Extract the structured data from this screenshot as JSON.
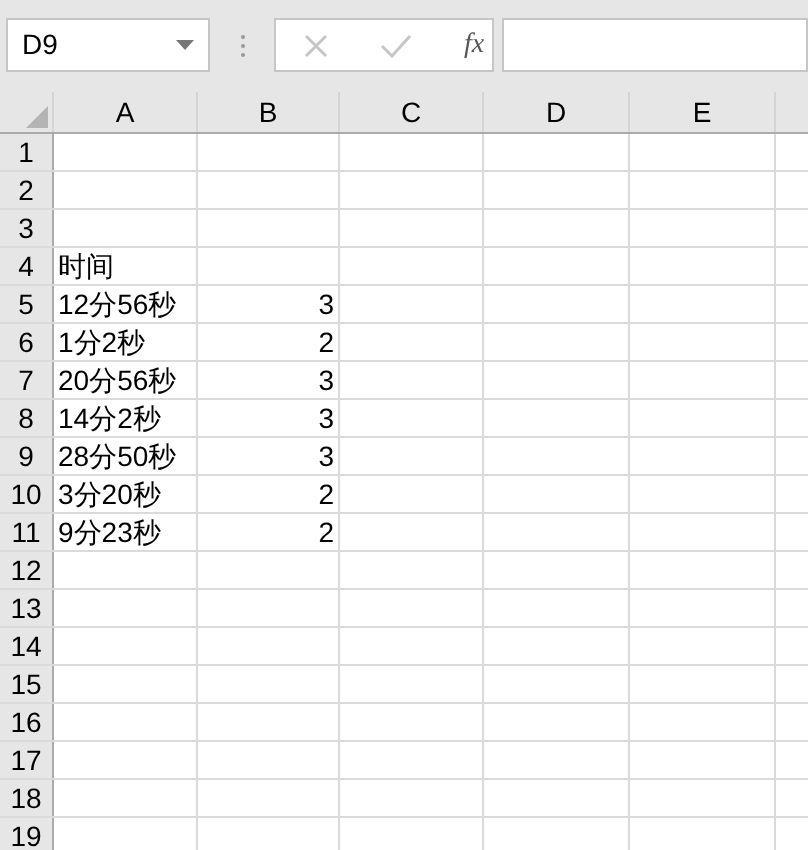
{
  "name_box": {
    "value": "D9"
  },
  "formula_bar": {
    "fx_label": "fx",
    "cancel_disabled": true,
    "enter_disabled": true
  },
  "columns": [
    "A",
    "B",
    "C",
    "D",
    "E"
  ],
  "rows": [
    {
      "number": "1",
      "cells": [
        "",
        ""
      ]
    },
    {
      "number": "2",
      "cells": [
        "",
        ""
      ]
    },
    {
      "number": "3",
      "cells": [
        "",
        ""
      ]
    },
    {
      "number": "4",
      "cells": [
        "时间",
        ""
      ]
    },
    {
      "number": "5",
      "cells": [
        "12分56秒",
        "3"
      ]
    },
    {
      "number": "6",
      "cells": [
        "1分2秒",
        "2"
      ]
    },
    {
      "number": "7",
      "cells": [
        "20分56秒",
        "3"
      ]
    },
    {
      "number": "8",
      "cells": [
        "14分2秒",
        "3"
      ]
    },
    {
      "number": "9",
      "cells": [
        "28分50秒",
        "3"
      ]
    },
    {
      "number": "10",
      "cells": [
        "3分20秒",
        "2"
      ]
    },
    {
      "number": "11",
      "cells": [
        "9分23秒",
        "2"
      ]
    },
    {
      "number": "12",
      "cells": [
        "",
        ""
      ]
    },
    {
      "number": "13",
      "cells": [
        "",
        ""
      ]
    },
    {
      "number": "14",
      "cells": [
        "",
        ""
      ]
    },
    {
      "number": "15",
      "cells": [
        "",
        ""
      ]
    },
    {
      "number": "16",
      "cells": [
        "",
        ""
      ]
    },
    {
      "number": "17",
      "cells": [
        "",
        ""
      ]
    },
    {
      "number": "18",
      "cells": [
        "",
        ""
      ]
    },
    {
      "number": "19",
      "cells": [
        "",
        ""
      ]
    }
  ]
}
